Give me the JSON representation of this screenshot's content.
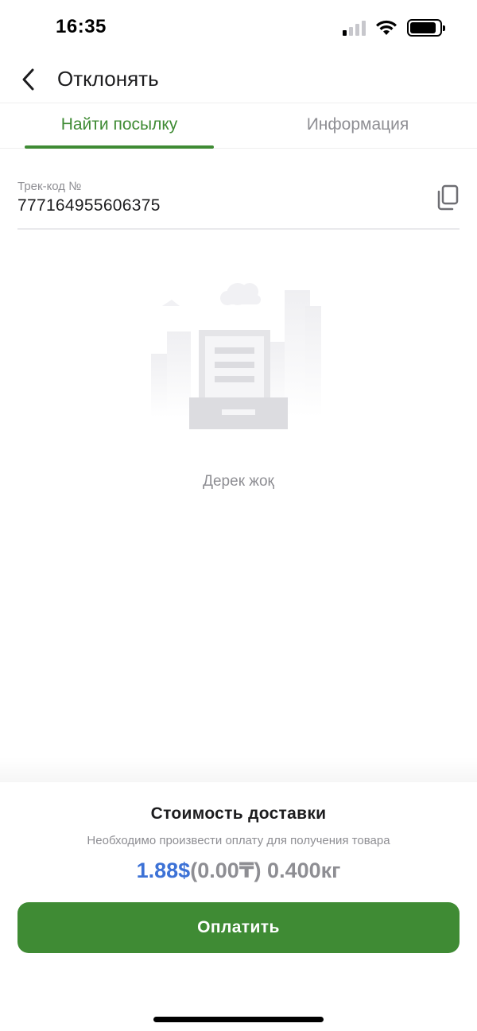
{
  "status_bar": {
    "time": "16:35",
    "signal_icon": "cellular-signal-icon",
    "wifi_icon": "wifi-icon",
    "battery_icon": "battery-icon",
    "battery_level": 0.9
  },
  "nav": {
    "back_icon": "chevron-left-icon",
    "title": "Отклонять"
  },
  "tabs": [
    {
      "label": "Найти посылку",
      "active": true
    },
    {
      "label": "Информация",
      "active": false
    }
  ],
  "track": {
    "label": "Трек-код №",
    "value": "777164955606375",
    "copy_icon": "copy-icon"
  },
  "empty_state": {
    "illustration_icon": "empty-document-tray-icon",
    "text": "Дерек жоқ"
  },
  "delivery": {
    "title": "Стоимость доставки",
    "subtitle": "Необходимо произвести оплату для получения товара",
    "price_usd": "1.88$",
    "price_kzt": "(0.00₸)",
    "weight": "0.400кг",
    "pay_label": "Оплатить"
  },
  "colors": {
    "accent_green": "#3f8b34",
    "price_blue": "#3d72d6",
    "muted_gray": "#8e8e93"
  }
}
